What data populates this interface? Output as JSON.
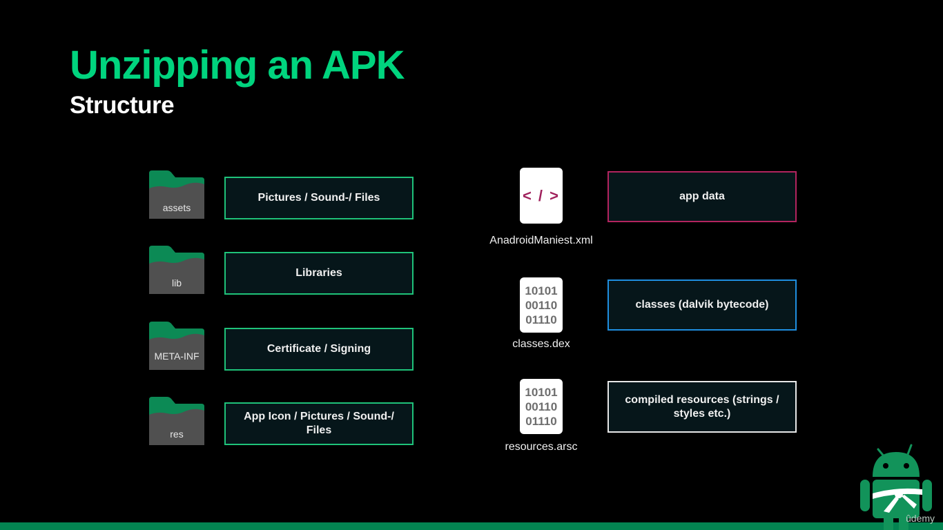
{
  "slide": {
    "title": "Unzipping an APK",
    "subtitle": "Structure"
  },
  "folders": [
    {
      "name": "assets",
      "description": "Pictures / Sound-/ Files"
    },
    {
      "name": "lib",
      "description": "Libraries"
    },
    {
      "name": "META-INF",
      "description": "Certificate / Signing"
    },
    {
      "name": "res",
      "description": "App Icon / Pictures / Sound-/ Files"
    }
  ],
  "files": [
    {
      "name": "AnadroidManiest.xml",
      "icon": "xml-code-icon",
      "glyph": "</>",
      "description": "app data",
      "accent": "#b3245f"
    },
    {
      "name": "classes.dex",
      "icon": "binary-file-icon",
      "glyph": "10101\n00110\n01110",
      "description": "classes (dalvik bytecode)",
      "accent": "#1f8fe0"
    },
    {
      "name": "resources.arsc",
      "icon": "binary-file-icon",
      "glyph": "10101\n00110\n01110",
      "description": "compiled resources (strings / styles etc.)",
      "accent": "#e8e8e8"
    }
  ],
  "colors": {
    "title": "#00d47e",
    "folder_box_border": "#1fc37a",
    "box_fill": "#06161a",
    "bottom_bar": "#038451"
  },
  "branding": {
    "watermark": "ûdemy"
  }
}
